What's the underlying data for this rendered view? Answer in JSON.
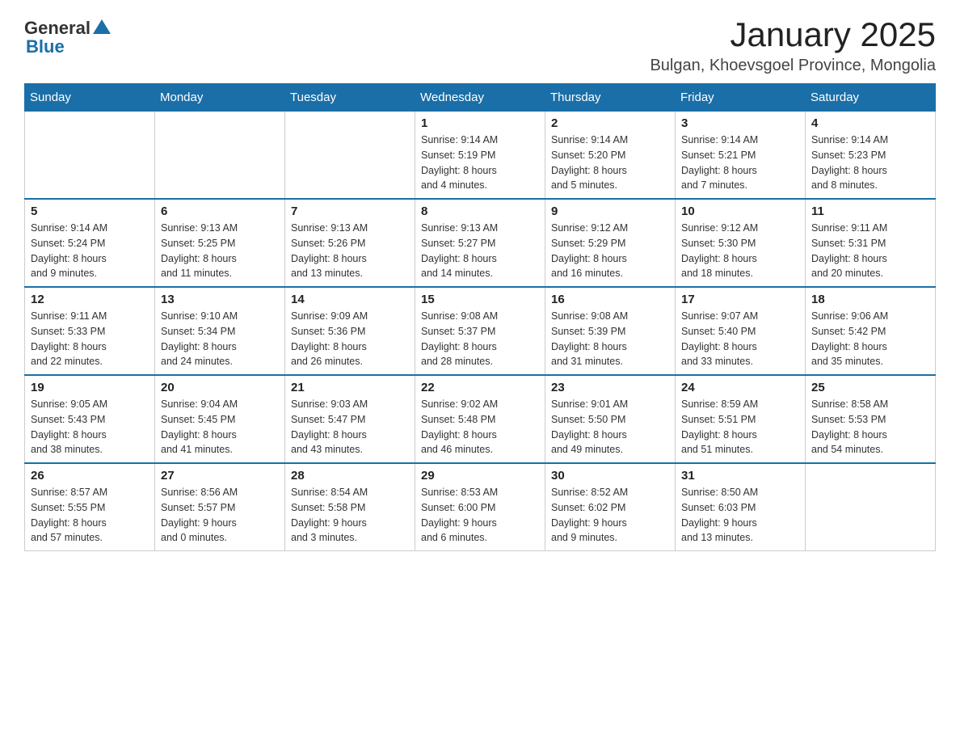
{
  "logo": {
    "general": "General",
    "blue": "Blue"
  },
  "header": {
    "month_title": "January 2025",
    "location": "Bulgan, Khoevsgoel Province, Mongolia"
  },
  "days_of_week": [
    "Sunday",
    "Monday",
    "Tuesday",
    "Wednesday",
    "Thursday",
    "Friday",
    "Saturday"
  ],
  "weeks": [
    [
      {
        "day": "",
        "info": ""
      },
      {
        "day": "",
        "info": ""
      },
      {
        "day": "",
        "info": ""
      },
      {
        "day": "1",
        "info": "Sunrise: 9:14 AM\nSunset: 5:19 PM\nDaylight: 8 hours\nand 4 minutes."
      },
      {
        "day": "2",
        "info": "Sunrise: 9:14 AM\nSunset: 5:20 PM\nDaylight: 8 hours\nand 5 minutes."
      },
      {
        "day": "3",
        "info": "Sunrise: 9:14 AM\nSunset: 5:21 PM\nDaylight: 8 hours\nand 7 minutes."
      },
      {
        "day": "4",
        "info": "Sunrise: 9:14 AM\nSunset: 5:23 PM\nDaylight: 8 hours\nand 8 minutes."
      }
    ],
    [
      {
        "day": "5",
        "info": "Sunrise: 9:14 AM\nSunset: 5:24 PM\nDaylight: 8 hours\nand 9 minutes."
      },
      {
        "day": "6",
        "info": "Sunrise: 9:13 AM\nSunset: 5:25 PM\nDaylight: 8 hours\nand 11 minutes."
      },
      {
        "day": "7",
        "info": "Sunrise: 9:13 AM\nSunset: 5:26 PM\nDaylight: 8 hours\nand 13 minutes."
      },
      {
        "day": "8",
        "info": "Sunrise: 9:13 AM\nSunset: 5:27 PM\nDaylight: 8 hours\nand 14 minutes."
      },
      {
        "day": "9",
        "info": "Sunrise: 9:12 AM\nSunset: 5:29 PM\nDaylight: 8 hours\nand 16 minutes."
      },
      {
        "day": "10",
        "info": "Sunrise: 9:12 AM\nSunset: 5:30 PM\nDaylight: 8 hours\nand 18 minutes."
      },
      {
        "day": "11",
        "info": "Sunrise: 9:11 AM\nSunset: 5:31 PM\nDaylight: 8 hours\nand 20 minutes."
      }
    ],
    [
      {
        "day": "12",
        "info": "Sunrise: 9:11 AM\nSunset: 5:33 PM\nDaylight: 8 hours\nand 22 minutes."
      },
      {
        "day": "13",
        "info": "Sunrise: 9:10 AM\nSunset: 5:34 PM\nDaylight: 8 hours\nand 24 minutes."
      },
      {
        "day": "14",
        "info": "Sunrise: 9:09 AM\nSunset: 5:36 PM\nDaylight: 8 hours\nand 26 minutes."
      },
      {
        "day": "15",
        "info": "Sunrise: 9:08 AM\nSunset: 5:37 PM\nDaylight: 8 hours\nand 28 minutes."
      },
      {
        "day": "16",
        "info": "Sunrise: 9:08 AM\nSunset: 5:39 PM\nDaylight: 8 hours\nand 31 minutes."
      },
      {
        "day": "17",
        "info": "Sunrise: 9:07 AM\nSunset: 5:40 PM\nDaylight: 8 hours\nand 33 minutes."
      },
      {
        "day": "18",
        "info": "Sunrise: 9:06 AM\nSunset: 5:42 PM\nDaylight: 8 hours\nand 35 minutes."
      }
    ],
    [
      {
        "day": "19",
        "info": "Sunrise: 9:05 AM\nSunset: 5:43 PM\nDaylight: 8 hours\nand 38 minutes."
      },
      {
        "day": "20",
        "info": "Sunrise: 9:04 AM\nSunset: 5:45 PM\nDaylight: 8 hours\nand 41 minutes."
      },
      {
        "day": "21",
        "info": "Sunrise: 9:03 AM\nSunset: 5:47 PM\nDaylight: 8 hours\nand 43 minutes."
      },
      {
        "day": "22",
        "info": "Sunrise: 9:02 AM\nSunset: 5:48 PM\nDaylight: 8 hours\nand 46 minutes."
      },
      {
        "day": "23",
        "info": "Sunrise: 9:01 AM\nSunset: 5:50 PM\nDaylight: 8 hours\nand 49 minutes."
      },
      {
        "day": "24",
        "info": "Sunrise: 8:59 AM\nSunset: 5:51 PM\nDaylight: 8 hours\nand 51 minutes."
      },
      {
        "day": "25",
        "info": "Sunrise: 8:58 AM\nSunset: 5:53 PM\nDaylight: 8 hours\nand 54 minutes."
      }
    ],
    [
      {
        "day": "26",
        "info": "Sunrise: 8:57 AM\nSunset: 5:55 PM\nDaylight: 8 hours\nand 57 minutes."
      },
      {
        "day": "27",
        "info": "Sunrise: 8:56 AM\nSunset: 5:57 PM\nDaylight: 9 hours\nand 0 minutes."
      },
      {
        "day": "28",
        "info": "Sunrise: 8:54 AM\nSunset: 5:58 PM\nDaylight: 9 hours\nand 3 minutes."
      },
      {
        "day": "29",
        "info": "Sunrise: 8:53 AM\nSunset: 6:00 PM\nDaylight: 9 hours\nand 6 minutes."
      },
      {
        "day": "30",
        "info": "Sunrise: 8:52 AM\nSunset: 6:02 PM\nDaylight: 9 hours\nand 9 minutes."
      },
      {
        "day": "31",
        "info": "Sunrise: 8:50 AM\nSunset: 6:03 PM\nDaylight: 9 hours\nand 13 minutes."
      },
      {
        "day": "",
        "info": ""
      }
    ]
  ]
}
